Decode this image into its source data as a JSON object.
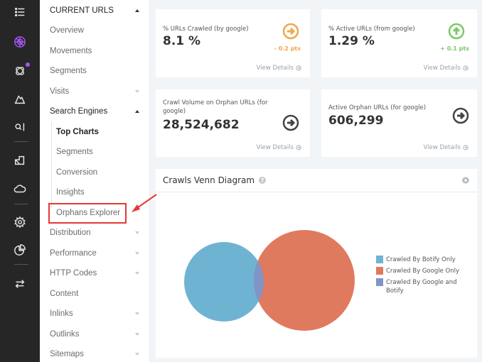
{
  "rail": {
    "icons": [
      {
        "name": "menu-list-icon"
      },
      {
        "name": "radar-icon",
        "active": true
      },
      {
        "name": "integrations-icon",
        "badge": true
      },
      {
        "name": "mountain-icon"
      },
      {
        "name": "search-cursor-icon"
      },
      {
        "name": "resize-icon"
      },
      {
        "name": "cloud-icon"
      },
      {
        "name": "gear-icon"
      },
      {
        "name": "pie-chart-icon"
      },
      {
        "name": "swap-arrows-icon"
      }
    ],
    "accent_color": "#a855f7"
  },
  "nav": {
    "section_title": "CURRENT URLS",
    "items": [
      {
        "label": "Overview"
      },
      {
        "label": "Movements"
      },
      {
        "label": "Segments"
      },
      {
        "label": "Visits"
      },
      {
        "label": "Search Engines"
      },
      {
        "label": "Top Charts"
      },
      {
        "label": "Segments"
      },
      {
        "label": "Conversion"
      },
      {
        "label": "Insights"
      },
      {
        "label": "Orphans Explorer"
      },
      {
        "label": "Distribution"
      },
      {
        "label": "Performance"
      },
      {
        "label": "HTTP Codes"
      },
      {
        "label": "Content"
      },
      {
        "label": "Inlinks"
      },
      {
        "label": "Outlinks"
      },
      {
        "label": "Sitemaps"
      }
    ],
    "highlight_color": "#e53935"
  },
  "kpis": [
    {
      "label": "% URLs Crawled (by google)",
      "value": "8.1 %",
      "delta": "- 0.2 pts",
      "trend": "flat",
      "color": "#f0a64b",
      "link": "View Details"
    },
    {
      "label": "% Active URLs (from google)",
      "value": "1.29 %",
      "delta": "+ 0.1 pts",
      "trend": "up",
      "color": "#7ac96b",
      "link": "View Details"
    },
    {
      "label": "Crawl Volume on Orphan URLs (for google)",
      "value": "28,524,682",
      "delta": "",
      "trend": "flat",
      "color": "#444444",
      "link": "View Details"
    },
    {
      "label": "Active Orphan URLs (for google)",
      "value": "606,299",
      "delta": "",
      "trend": "flat",
      "color": "#444444",
      "link": "View Details"
    }
  ],
  "venn": {
    "title": "Crawls Venn Diagram",
    "help": "?",
    "legend": [
      {
        "label": "Crawled By Botify Only",
        "color": "#6fb3d3"
      },
      {
        "label": "Crawled By Google Only",
        "color": "#e07a5f"
      },
      {
        "label": "Crawled By Google and Botify",
        "color": "#8094c8"
      }
    ]
  }
}
